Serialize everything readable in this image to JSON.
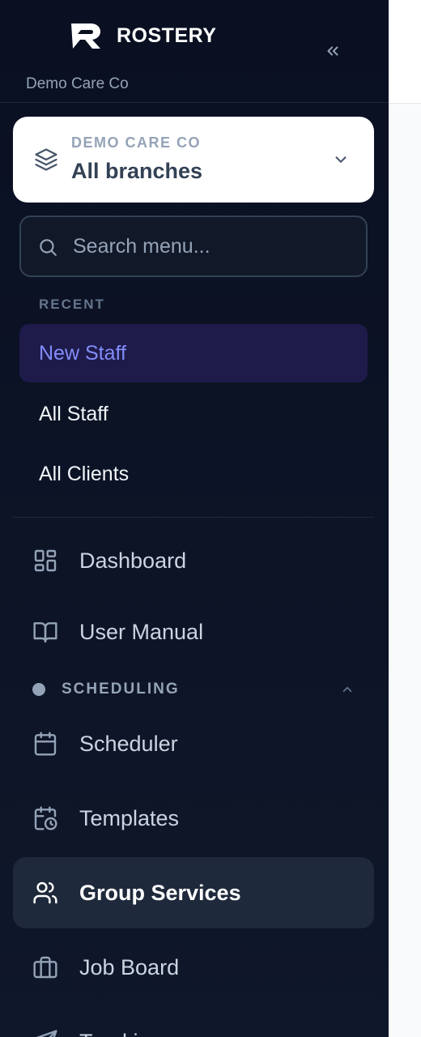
{
  "brand": {
    "name": "ROSTERY",
    "org_subtitle": "Demo Care Co"
  },
  "branch_selector": {
    "org_label": "DEMO CARE CO",
    "branch_label": "All branches"
  },
  "search": {
    "placeholder": "Search menu..."
  },
  "recent": {
    "heading": "RECENT",
    "items": [
      {
        "label": "New Staff",
        "active": true
      },
      {
        "label": "All Staff",
        "active": false
      },
      {
        "label": "All Clients",
        "active": false
      }
    ]
  },
  "nav": {
    "dashboard": {
      "label": "Dashboard",
      "icon": "dashboard-icon"
    },
    "user_manual": {
      "label": "User Manual",
      "icon": "book-icon"
    },
    "section": {
      "label": "SCHEDULING",
      "expanded": true
    },
    "scheduler": {
      "label": "Scheduler",
      "icon": "calendar-icon"
    },
    "templates": {
      "label": "Templates",
      "icon": "calendar-clock-icon"
    },
    "group_services": {
      "label": "Group Services",
      "icon": "users-icon",
      "active": true
    },
    "job_board": {
      "label": "Job Board",
      "icon": "briefcase-icon"
    },
    "tracking": {
      "label": "Tracking",
      "icon": "send-icon"
    }
  },
  "colors": {
    "sidebar_bg": "#0f172a",
    "active_recent_bg": "#1e1b4b",
    "active_recent_text": "#818cf8",
    "active_nav_bg": "#1e293b"
  }
}
